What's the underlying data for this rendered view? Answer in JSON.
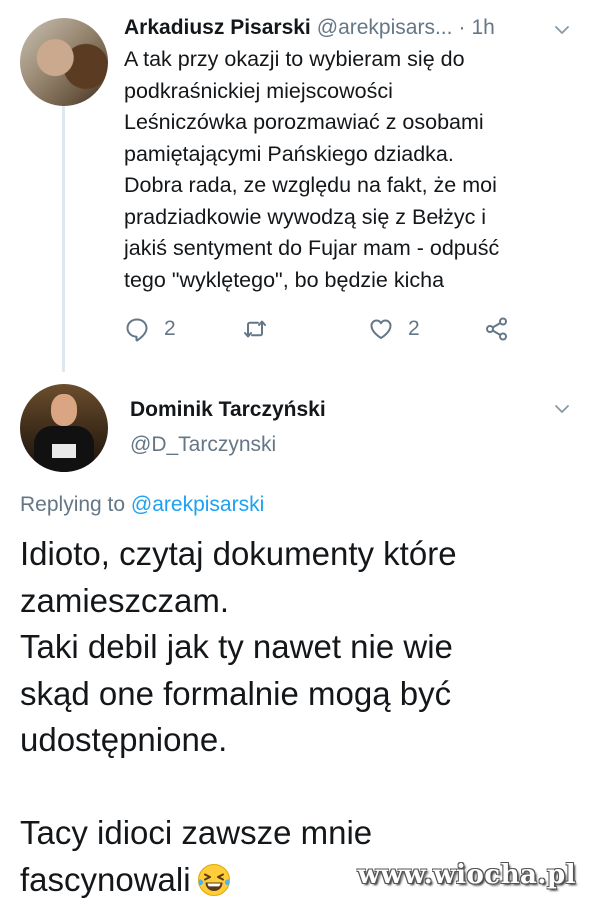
{
  "tweet1": {
    "author_name": "Arkadiusz Pisarski",
    "author_handle": "@arekpisars...",
    "separator": "·",
    "time": "1h",
    "lines": [
      "A tak przy okazji to wybieram się do",
      "podkraśnickiej miejscowości",
      "Leśniczówka porozmawiać z osobami",
      "pamiętającymi Pańskiego dziadka.",
      "Dobra rada, ze względu na fakt, że moi",
      "pradziadkowie wywodzą się z Bełżyc i",
      "jakiś sentyment do Fujar mam - odpuść",
      "tego \"wyklętego\", bo będzie kicha"
    ],
    "reply_count": "2",
    "like_count": "2"
  },
  "tweet2": {
    "author_name": "Dominik Tarczyński",
    "author_handle": "@D_Tarczynski",
    "replying_prefix": "Replying to",
    "replying_handle": "@arekpisarski",
    "text": "Idioto, czytaj dokumenty które\nzamieszczam.\nTaki debil jak ty nawet nie wie\nskąd one formalnie mogą być\nudostępnione.\n\nTacy idioci zawsze mnie\nfascynowali"
  },
  "icons": {
    "reply": "reply-icon",
    "retweet": "retweet-icon",
    "like": "heart-icon",
    "share": "share-icon",
    "menu": "chevron-down-icon",
    "emoji": "grinning-squinting-face-with-tears-icon"
  },
  "colors": {
    "text": "#14171a",
    "secondary": "#657786",
    "link": "#1da1f2",
    "thread_line": "#e1e8ed"
  },
  "watermark": "www.wiocha.pl"
}
